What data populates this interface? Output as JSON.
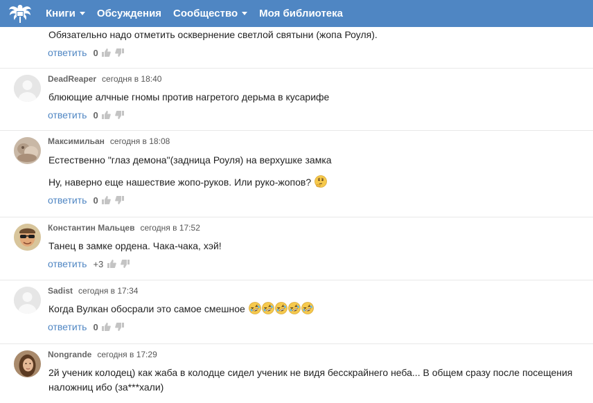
{
  "nav": {
    "items": [
      {
        "label": "Книги",
        "dropdown": true
      },
      {
        "label": "Обсуждения",
        "dropdown": false
      },
      {
        "label": "Сообщество",
        "dropdown": true
      },
      {
        "label": "Моя библиотека",
        "dropdown": false
      }
    ],
    "logo_icon": "double-headed-eagle-logo"
  },
  "colors": {
    "topbar": "#4f86c3",
    "link": "#4f86c3",
    "author": "#666666",
    "vote_icon": "#c4c4c4"
  },
  "comments": [
    {
      "author": "",
      "time": "",
      "lines": [
        "Обязательно надо отметить осквернение светлой святыни (жопа Роуля)."
      ],
      "reply_label": "ответить",
      "score": "0"
    },
    {
      "author": "DeadReaper",
      "time": "сегодня в 18:40",
      "avatar_icon": "default-avatar-icon",
      "lines": [
        "блюющие алчные гномы против нагретого дерьма в кусарифе"
      ],
      "reply_label": "ответить",
      "score": "0"
    },
    {
      "author": "Максимильан",
      "time": "сегодня в 18:08",
      "avatar_icon": "photo-avatar",
      "lines": [
        "Естественно \"глаз демона\"(задница Роуля) на верхушке замка",
        "Ну, наверно еще нашествие жопо-руков. Или руко-жопов?"
      ],
      "emoji_line2": "thinking-face-emoji",
      "reply_label": "ответить",
      "score": "0"
    },
    {
      "author": "Константин Мальцев",
      "time": "сегодня в 17:52",
      "avatar_icon": "photo-avatar-sunglasses",
      "lines": [
        "Танец в замке ордена. Чака-чака, хэй!"
      ],
      "reply_label": "ответить",
      "score": "+3"
    },
    {
      "author": "Sadist",
      "time": "сегодня в 17:34",
      "avatar_icon": "default-avatar-icon",
      "lines": [
        "Когда Вулкан обосрали это самое смешное"
      ],
      "emoji_count": 5,
      "emoji": "rolling-on-floor-laughing-emoji",
      "reply_label": "ответить",
      "score": "0"
    },
    {
      "author": "Nongrande",
      "time": "сегодня в 17:29",
      "avatar_icon": "photo-avatar-woman",
      "lines": [
        "2й ученик колодец) как жаба в колодце сидел ученик не видя бесскрайнего неба... В общем сразу после посещения наложниц ибо (за***хали)"
      ]
    }
  ]
}
